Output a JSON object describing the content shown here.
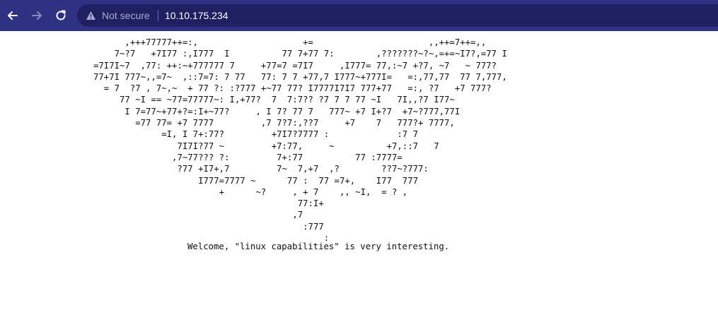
{
  "toolbar": {
    "back_icon": "arrow-left-icon",
    "forward_icon": "arrow-right-icon",
    "reload_icon": "reload-icon",
    "warning_icon": "warning-triangle-icon",
    "security_label": "Not secure",
    "url": "10.10.175.234"
  },
  "page": {
    "ascii_art": "      ,+++77777++=:,                    +=                      ,,++=7++=,,\n    7~?7   +7I77 :,I777  I          77 7+77 7:        ,???????~?~,=+=~I7?,=77 I\n=7I7I~7  ,77: ++:~+777777 7     +77=7 =7I7     ,I777= 77,:~7 +?7, ~7   ~ 777?\n77+7I 777~,,=7~  ,::7=7: 7 77   77: 7 7 +77,7 I777~+777I=   =:,77,77  77 7,777,\n  = 7  ?7 , 7~,~  + 77 ?: :?777 +~77 77? I7777I7I7 777+77   =:, ?7   +7 777?\n     77 ~I == ~77=77777~: I,+77?  7  7:7?? ?7 7 7 77 ~I   7I,,?7 I77~\n      I 7=77~+77+?=:I+~77?     , I 7? 77 7   777~ +7 I+?7  +7~?777,77I\n        =77 77= +7 7777         ,7 7?7:,??7     +7    7   777?+ 7777,\n             =I, I 7+:77?         +7I7?7777 :             :7 7\n                7I7I?77 ~         +7:77,     ~          +7,::7   7\n               ,7~77??? ?:         7+:77          77 :7777=\n                ?77 +I7+,7         7~  7,+7  ,?        ??7~?777:\n                    I777=7777 ~      77 :  77 =7+,    I77  777\n                        +      ~?     , + 7    ,, ~I,  = ? ,\n                                       77:I+\n                                      ,7\n                                        :777\n                                            :",
    "message": "Welcome, \"linux capabilities\" is very interesting."
  },
  "colors": {
    "toolbar_background": "#2f3183",
    "omnibox_background": "#1f2061",
    "not_secure_text": "#a9abd4",
    "url_text": "#ffffff",
    "page_background": "#ffffff",
    "page_text": "#111111"
  }
}
